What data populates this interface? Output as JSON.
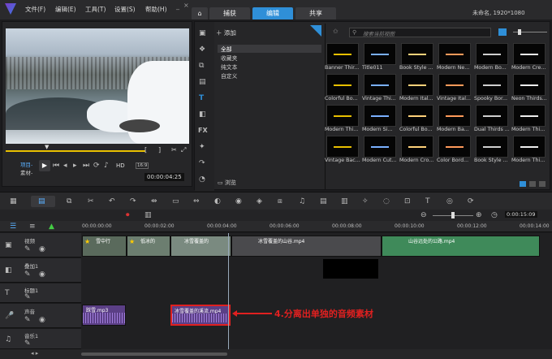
{
  "menu": {
    "file": "文件(F)",
    "edit": "编辑(E)",
    "tools": "工具(T)",
    "settings": "设置(S)",
    "help": "帮助(H)"
  },
  "tabs": {
    "capture": "捕获",
    "edit": "编辑",
    "share": "共享"
  },
  "project_title": "未命名, 1920*1080",
  "preview": {
    "project_label": "项目-",
    "clip_label": "素材-",
    "hd": "HD",
    "zoom": "16:9",
    "timecode": "00:00:04:25"
  },
  "library": {
    "add": "添加",
    "folders": [
      "全部",
      "收藏夹",
      "纯文本",
      "自定义"
    ],
    "search_placeholder": "搜索当前视图",
    "browse": "浏览",
    "fx": "FX",
    "items": [
      "Banner Thir...",
      "Title011",
      "Book Style ...",
      "Modern Ne...",
      "Modern Bo...",
      "Modern Cre...",
      "Colorful Bo...",
      "Vintage Thi...",
      "Modern Ital...",
      "Vintage Ital...",
      "Spooky Bor...",
      "Neon Thirds...",
      "Modern Thi...",
      "Modern Si...",
      "Colorful Bo...",
      "Modern Ba...",
      "Dual Thirds ...",
      "Modern Thi...",
      "Vintage Bac...",
      "Modern Cut...",
      "Modern Cro...",
      "Color Bord...",
      "Book Style ...",
      "Modern Thi..."
    ]
  },
  "ruler": [
    "00:00:00:00",
    "00:00:02:00",
    "00:00:04:00",
    "00:00:06:00",
    "00:00:08:00",
    "00:00:10:00",
    "00:00:12:00",
    "00:00:14:00"
  ],
  "timeline_timecode": "0:00:15:09",
  "tracks": {
    "video": "视频",
    "overlay": "叠加1",
    "title": "标题1",
    "voice": "声音",
    "music": "音乐1"
  },
  "clips": {
    "v1": "雪中行",
    "v2": "低冰的",
    "v3": "冰雪覆盖的",
    "v4": "冰雪覆盖的山谷.mp4",
    "v5": "山谷远处的公路.mp4",
    "a1": "踩雪.mp3",
    "a2": "冰雪覆盖的溪流.mp4"
  },
  "annotation": "4.分离出单独的音频素材",
  "colors": {
    "accent": "#2f8fd8",
    "annotation": "#e02020"
  }
}
